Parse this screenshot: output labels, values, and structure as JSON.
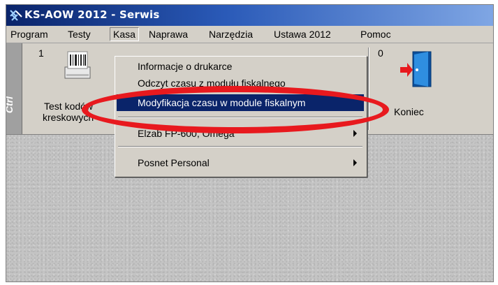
{
  "window": {
    "title": "KS-AOW 2012 - Serwis"
  },
  "menubar": {
    "items": [
      "Program",
      "Testy",
      "Kasa",
      "Naprawa",
      "Narzędzia",
      "Ustawa 2012",
      "Pomoc"
    ],
    "active": "Kasa"
  },
  "toolbar": {
    "ctl_label": "Ctrl",
    "buttons": [
      {
        "number": "1",
        "label_line1": "Test kodów",
        "label_line2": "kreskowych",
        "icon": "barcode-printer-icon"
      },
      {
        "number": "0",
        "label_line1": "Koniec",
        "icon": "exit-door-icon"
      }
    ]
  },
  "kasa_menu": {
    "items": [
      {
        "label": "Informacje o drukarce",
        "submenu": false
      },
      {
        "label": "Odczyt czasu z modułu fiskalnego",
        "submenu": false
      },
      {
        "label": "Modyfikacja czasu w module fiskalnym",
        "submenu": false,
        "highlighted": true
      },
      {
        "label": "Elzab FP-600, Omega",
        "submenu": true
      },
      {
        "label": "Posnet Personal",
        "submenu": true
      }
    ]
  },
  "colors": {
    "title_bar": "#0a246a",
    "menu_highlight": "#0a246a",
    "annotation_oval": "#e8191e",
    "exit_icon": "#1a73c8"
  }
}
